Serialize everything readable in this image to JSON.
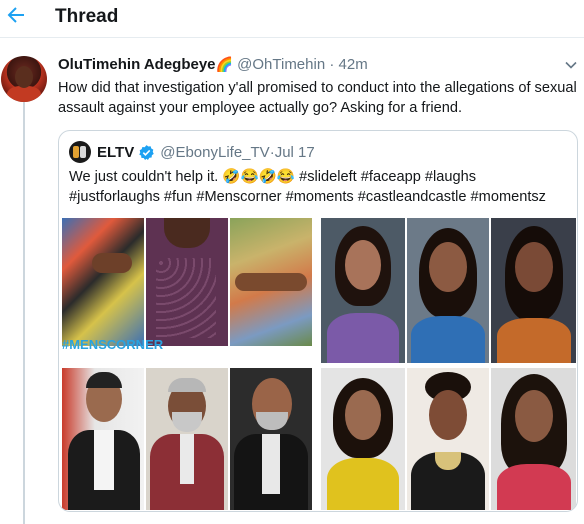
{
  "header": {
    "back_icon": "arrow-left-icon",
    "title": "Thread",
    "accent": "#1da1f2"
  },
  "tweet": {
    "author_name": "OluTimehin Adegbeye",
    "author_emoji": "🌈",
    "handle": "@OhTimehin",
    "separator": " · ",
    "time": "42m",
    "text": "How did that investigation y'all promised to conduct into the allegations of sexual assault against your employee actually go? Asking for a friend.",
    "menu_icon": "chevron-down-icon"
  },
  "quoted": {
    "name": "ELTV",
    "verified_icon": "verified-badge-icon",
    "handle": "@EbonyLife_TV",
    "separator": " · ",
    "date": "Jul 17",
    "text": "We just couldn't help it. 🤣😂🤣😂 #slideleft #faceapp #laughs #justforlaughs #fun #Menscorner #moments #castleandcastle #momentsz",
    "media_watermark": "#MENSCORNER",
    "media_caption": "@EbonyLife_TV faceapp collage of men and women portraits"
  }
}
